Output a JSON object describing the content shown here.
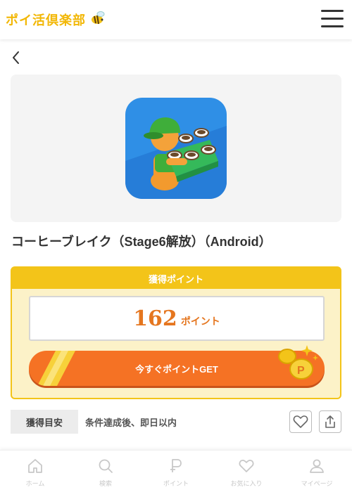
{
  "header": {
    "logo_text": "ポイ活倶楽部",
    "logo_icon": "bee-icon",
    "menu_icon": "hamburger-menu-icon"
  },
  "nav": {
    "back_icon": "chevron-left-icon"
  },
  "offer": {
    "title": "コーヒーブレイク（Stage6解放）（Android）",
    "app_icon": "coffee-break-app-icon"
  },
  "points": {
    "header": "獲得ポイント",
    "value": "162",
    "unit": "ポイント",
    "cta_label": "今すぐポイントGET",
    "cta_icon": "coins-icon"
  },
  "guide": {
    "label": "獲得目安",
    "text": "条件達成後、即日以内"
  },
  "actions": {
    "favorite_icon": "heart-icon",
    "share_icon": "share-icon"
  },
  "bottom_nav": {
    "items": [
      {
        "label": "ホーム",
        "icon": "home-icon"
      },
      {
        "label": "検索",
        "icon": "search-icon"
      },
      {
        "label": "ポイント",
        "icon": "point-icon"
      },
      {
        "label": "お気に入り",
        "icon": "heart-icon"
      },
      {
        "label": "マイページ",
        "icon": "user-icon"
      }
    ]
  },
  "colors": {
    "brand_yellow": "#f3c419",
    "cta_orange": "#f57224",
    "points_orange": "#e5761f",
    "panel_cream": "#fcf2c8"
  }
}
